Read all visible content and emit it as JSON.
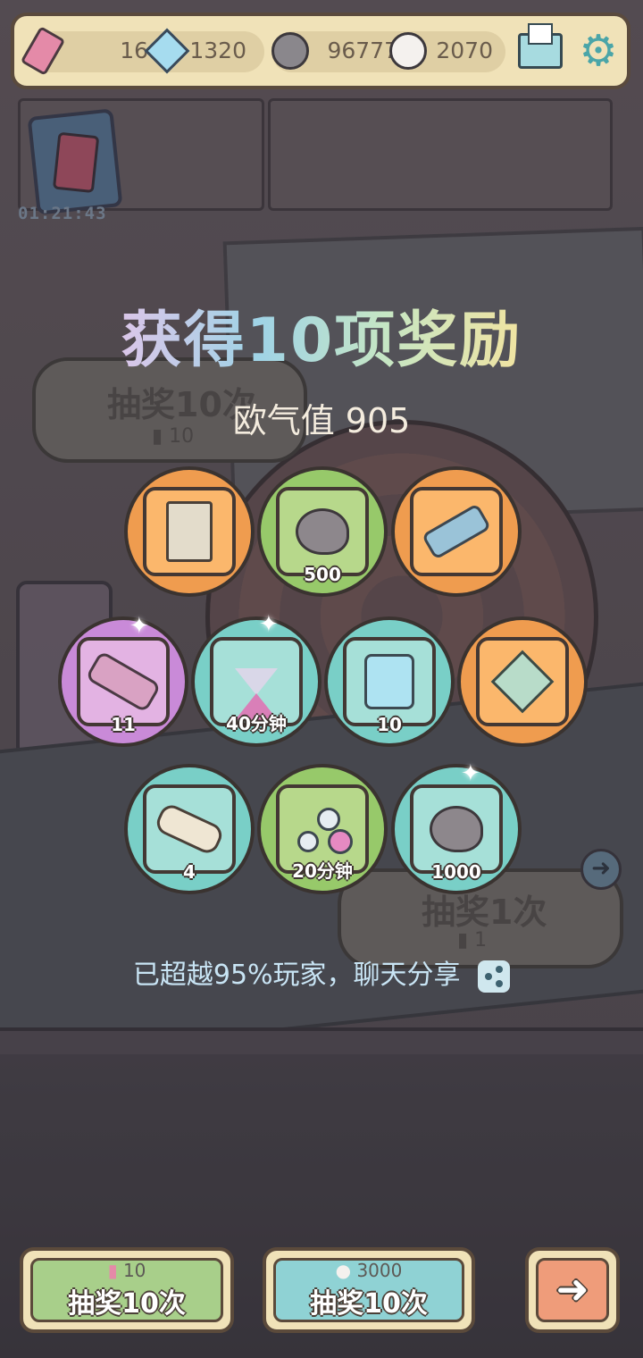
{
  "topbar": {
    "ticket": {
      "icon": "pink-ticket-icon",
      "value": "16"
    },
    "crystal": {
      "icon": "blue-crystal-icon",
      "value": "1320"
    },
    "gray_bubble": {
      "icon": "gray-speech-bubble-icon",
      "value": "96777"
    },
    "white_bubble": {
      "icon": "white-speech-bubble-icon",
      "value": "2070"
    },
    "mail_icon": "mail-icon",
    "settings_icon": "gear-icon"
  },
  "event": {
    "timer": "01:21:43"
  },
  "background": {
    "draw10_label": "抽奖10次",
    "draw10_cost": "10",
    "draw1_label": "抽奖1次",
    "draw1_cost": "1"
  },
  "result": {
    "title": "获得10项奖励",
    "luck_label": "欧气值 905",
    "items": [
      {
        "icon": "stone-tablet-icon",
        "qty": "",
        "color": "orange"
      },
      {
        "icon": "gray-blob-icon",
        "qty": "500",
        "color": "green"
      },
      {
        "icon": "telescope-icon",
        "qty": "",
        "color": "orange"
      },
      {
        "icon": "pink-scope-icon",
        "qty": "11",
        "color": "purple"
      },
      {
        "icon": "hourglass-icon",
        "qty": "40分钟",
        "color": "cyan"
      },
      {
        "icon": "potion-bottle-icon",
        "qty": "10",
        "color": "cyan"
      },
      {
        "icon": "crystal-cluster-icon",
        "qty": "",
        "color": "orange"
      },
      {
        "icon": "scroll-icon",
        "qty": "4",
        "color": "cyan"
      },
      {
        "icon": "molecule-icon",
        "qty": "20分钟",
        "color": "green"
      },
      {
        "icon": "gray-blob-icon",
        "qty": "1000",
        "color": "cyan"
      }
    ],
    "share_text": "已超越95%玩家，聊天分享"
  },
  "buttons": {
    "ticket_draw": {
      "cost": "10",
      "label": "抽奖10次",
      "color": "#a8cf8a"
    },
    "bubble_draw": {
      "cost": "3000",
      "label": "抽奖10次",
      "color": "#8fd2d4"
    },
    "next_icon": "arrow-right-icon"
  },
  "colors": {
    "orange": "#ef9c4f",
    "green": "#97c96a",
    "purple": "#c98ad8",
    "cyan": "#79cfc7"
  }
}
